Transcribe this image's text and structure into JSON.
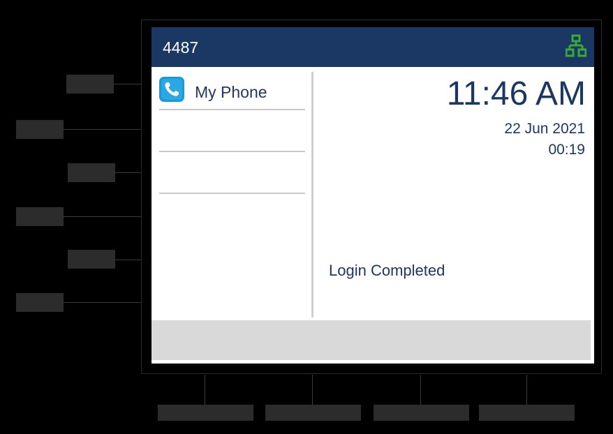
{
  "header": {
    "extension": "4487",
    "network_icon": "network-connected-icon",
    "network_color": "#3aa935"
  },
  "line_keys": [
    {
      "label": "My Phone",
      "icon": "phone-icon",
      "icon_color": "#1a9ad8"
    },
    {
      "label": ""
    },
    {
      "label": ""
    }
  ],
  "status_area": {
    "time": "11:46 AM",
    "date": "22 Jun 2021",
    "call_duration": "00:19",
    "message": "Login Completed"
  },
  "colors": {
    "header_bg": "#1b3764",
    "text_primary": "#1b3764",
    "softkey_bar_bg": "#d9d9d9"
  }
}
